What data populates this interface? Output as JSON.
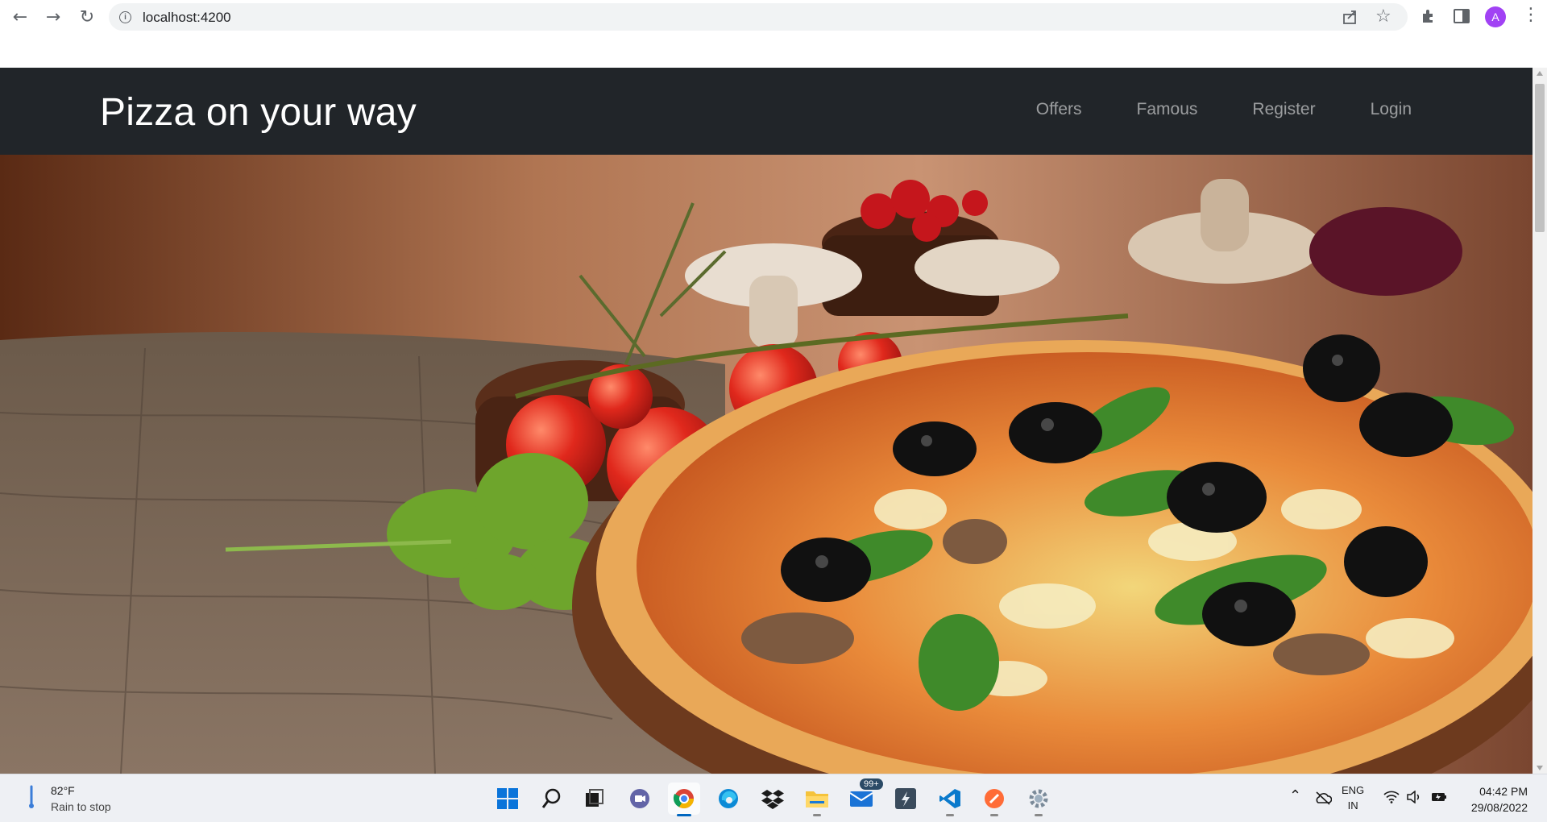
{
  "browser": {
    "url": "localhost:4200",
    "avatar_letter": "A"
  },
  "site": {
    "brand": "Pizza on your way",
    "nav": [
      {
        "label": "Offers"
      },
      {
        "label": "Famous"
      },
      {
        "label": "Register"
      },
      {
        "label": "Login"
      }
    ]
  },
  "taskbar": {
    "weather": {
      "temp": "82°F",
      "desc": "Rain to stop"
    },
    "mail_badge": "99+",
    "language": {
      "line1": "ENG",
      "line2": "IN"
    },
    "clock": {
      "time": "04:42 PM",
      "date": "29/08/2022"
    },
    "apps": [
      "start-icon",
      "search-icon",
      "task-view-icon",
      "teams-icon",
      "chrome-icon",
      "edge-icon",
      "dropbox-icon",
      "file-explorer-icon",
      "mail-icon",
      "terminal-icon",
      "vscode-icon",
      "postman-icon",
      "settings-icon"
    ]
  },
  "colors": {
    "navbar_bg": "#212529",
    "brand_text": "#ffffff",
    "nav_link": "rgba(255,255,255,0.55)",
    "taskbar_bg": "#eef0f4"
  }
}
